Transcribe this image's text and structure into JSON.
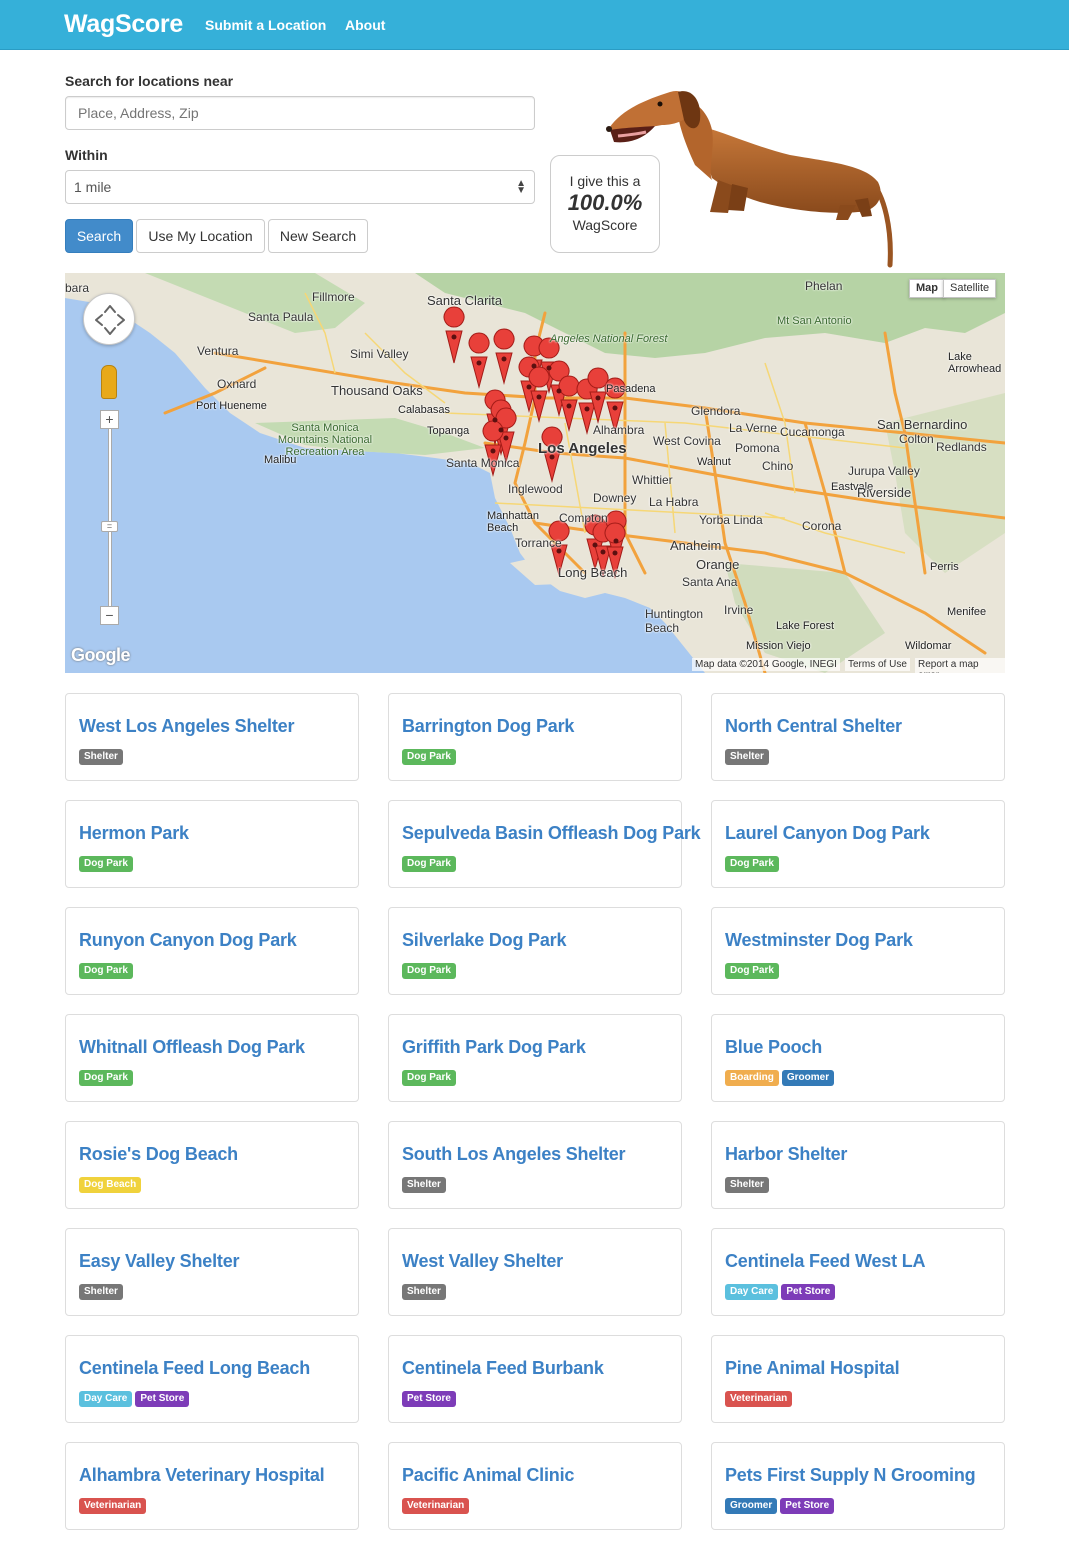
{
  "nav": {
    "brand": "WagScore",
    "links": [
      "Submit a Location",
      "About"
    ]
  },
  "search": {
    "label": "Search for locations near",
    "placeholder": "Place, Address, Zip",
    "within_label": "Within",
    "within_value": "1 mile",
    "buttons": [
      "Search",
      "Use My Location",
      "New Search"
    ]
  },
  "score": {
    "intro": "I give this a",
    "value": "100.0%",
    "unit": "WagScore"
  },
  "map": {
    "type_buttons": [
      "Map",
      "Satellite"
    ],
    "attribution": "Map data ©2014 Google, INEGI",
    "terms": "Terms of Use",
    "report": "Report a map error",
    "logo": "Google",
    "cities": [
      "bara",
      "Fillmore",
      "Santa Clarita",
      "Phelan",
      "Santa Paula",
      "Ventura",
      "Simi Valley",
      "Angeles National Forest",
      "Mt San Antonio",
      "Oxnard",
      "Thousand Oaks",
      "Port Hueneme",
      "Calabasas",
      "Glendora",
      "San Bernardino",
      "Topanga",
      "Los Angeles",
      "West Covina",
      "La Verne",
      "Cucamonga",
      "Colton",
      "Redlands",
      "Santa Monica Mountains National Recreation Area",
      "Malibu",
      "Santa Monica",
      "Pomona",
      "Chino",
      "Jurupa Valley",
      "Inglewood",
      "Whittier",
      "Eastvale",
      "Riverside",
      "Downey",
      "La Habra",
      "Manhattan Beach",
      "Compton",
      "Yorba Linda",
      "Corona",
      "Torrance",
      "Anaheim",
      "Long Beach",
      "Orange",
      "Perris",
      "Santa Ana",
      "Huntington Beach",
      "Irvine",
      "Lake Forest",
      "Menifee",
      "Mission Viejo",
      "Wildomar",
      "Lake Arrowhead",
      "Alhambra",
      "Walnut",
      "Pasadena"
    ]
  },
  "tag_colors": {
    "Shelter": "#777777",
    "Dog Park": "#5cb85c",
    "Boarding": "#f0ad4e",
    "Groomer": "#337ab7",
    "Dog Beach": "#f0d23c",
    "Day Care": "#5bc0de",
    "Pet Store": "#7d3cb8",
    "Veterinarian": "#d9534f"
  },
  "locations": [
    {
      "name": "West Los Angeles Shelter",
      "tags": [
        "Shelter"
      ]
    },
    {
      "name": "Barrington Dog Park",
      "tags": [
        "Dog Park"
      ]
    },
    {
      "name": "North Central Shelter",
      "tags": [
        "Shelter"
      ]
    },
    {
      "name": "Hermon Park",
      "tags": [
        "Dog Park"
      ]
    },
    {
      "name": "Sepulveda Basin Offleash Dog Park",
      "tags": [
        "Dog Park"
      ]
    },
    {
      "name": "Laurel Canyon Dog Park",
      "tags": [
        "Dog Park"
      ]
    },
    {
      "name": "Runyon Canyon Dog Park",
      "tags": [
        "Dog Park"
      ]
    },
    {
      "name": "Silverlake Dog Park",
      "tags": [
        "Dog Park"
      ]
    },
    {
      "name": "Westminster Dog Park",
      "tags": [
        "Dog Park"
      ]
    },
    {
      "name": "Whitnall Offleash Dog Park",
      "tags": [
        "Dog Park"
      ]
    },
    {
      "name": "Griffith Park Dog Park",
      "tags": [
        "Dog Park"
      ]
    },
    {
      "name": "Blue Pooch",
      "tags": [
        "Boarding",
        "Groomer"
      ]
    },
    {
      "name": "Rosie's Dog Beach",
      "tags": [
        "Dog Beach"
      ]
    },
    {
      "name": "South Los Angeles Shelter",
      "tags": [
        "Shelter"
      ]
    },
    {
      "name": "Harbor Shelter",
      "tags": [
        "Shelter"
      ]
    },
    {
      "name": "Easy Valley Shelter",
      "tags": [
        "Shelter"
      ]
    },
    {
      "name": "West Valley Shelter",
      "tags": [
        "Shelter"
      ]
    },
    {
      "name": "Centinela Feed West LA",
      "tags": [
        "Day Care",
        "Pet Store"
      ]
    },
    {
      "name": "Centinela Feed Long Beach",
      "tags": [
        "Day Care",
        "Pet Store"
      ]
    },
    {
      "name": "Centinela Feed Burbank",
      "tags": [
        "Pet Store"
      ]
    },
    {
      "name": "Pine Animal Hospital",
      "tags": [
        "Veterinarian"
      ]
    },
    {
      "name": "Alhambra Veterinary Hospital",
      "tags": [
        "Veterinarian"
      ]
    },
    {
      "name": "Pacific Animal Clinic",
      "tags": [
        "Veterinarian"
      ]
    },
    {
      "name": "Pets First Supply N Grooming",
      "tags": [
        "Groomer",
        "Pet Store"
      ]
    }
  ]
}
